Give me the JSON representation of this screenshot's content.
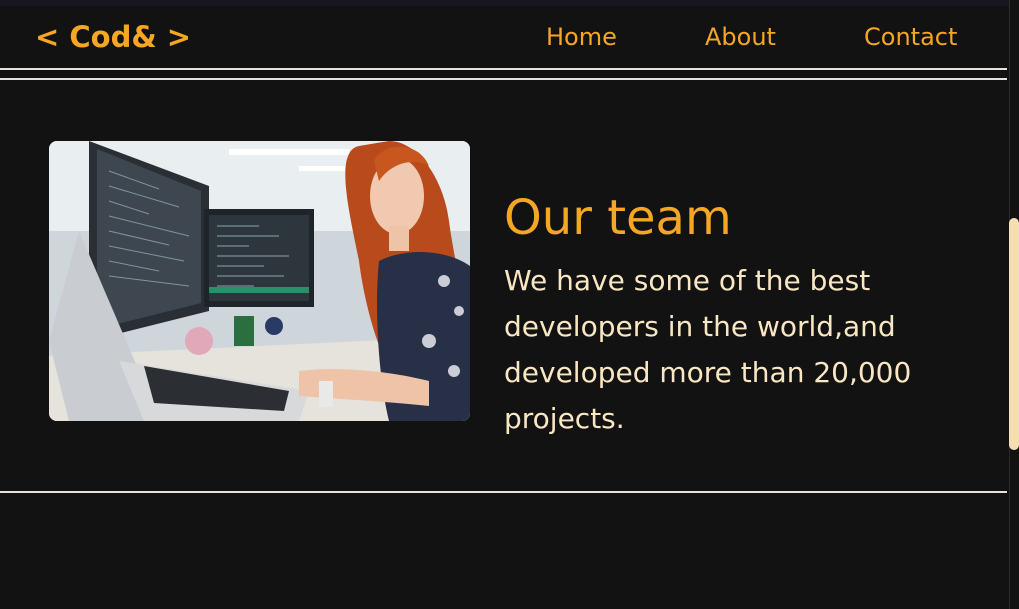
{
  "header": {
    "logo": "< Cod& >",
    "nav": [
      {
        "label": "Home"
      },
      {
        "label": "About"
      },
      {
        "label": "Contact"
      }
    ]
  },
  "team": {
    "title": "Our team",
    "description": "We have some of the best developers in the world,and developed more than 20,000 projects."
  },
  "colors": {
    "background": "#121212",
    "accent": "#f5a623",
    "text": "#f9e6c2",
    "scrollbar": "#f5deb1"
  }
}
